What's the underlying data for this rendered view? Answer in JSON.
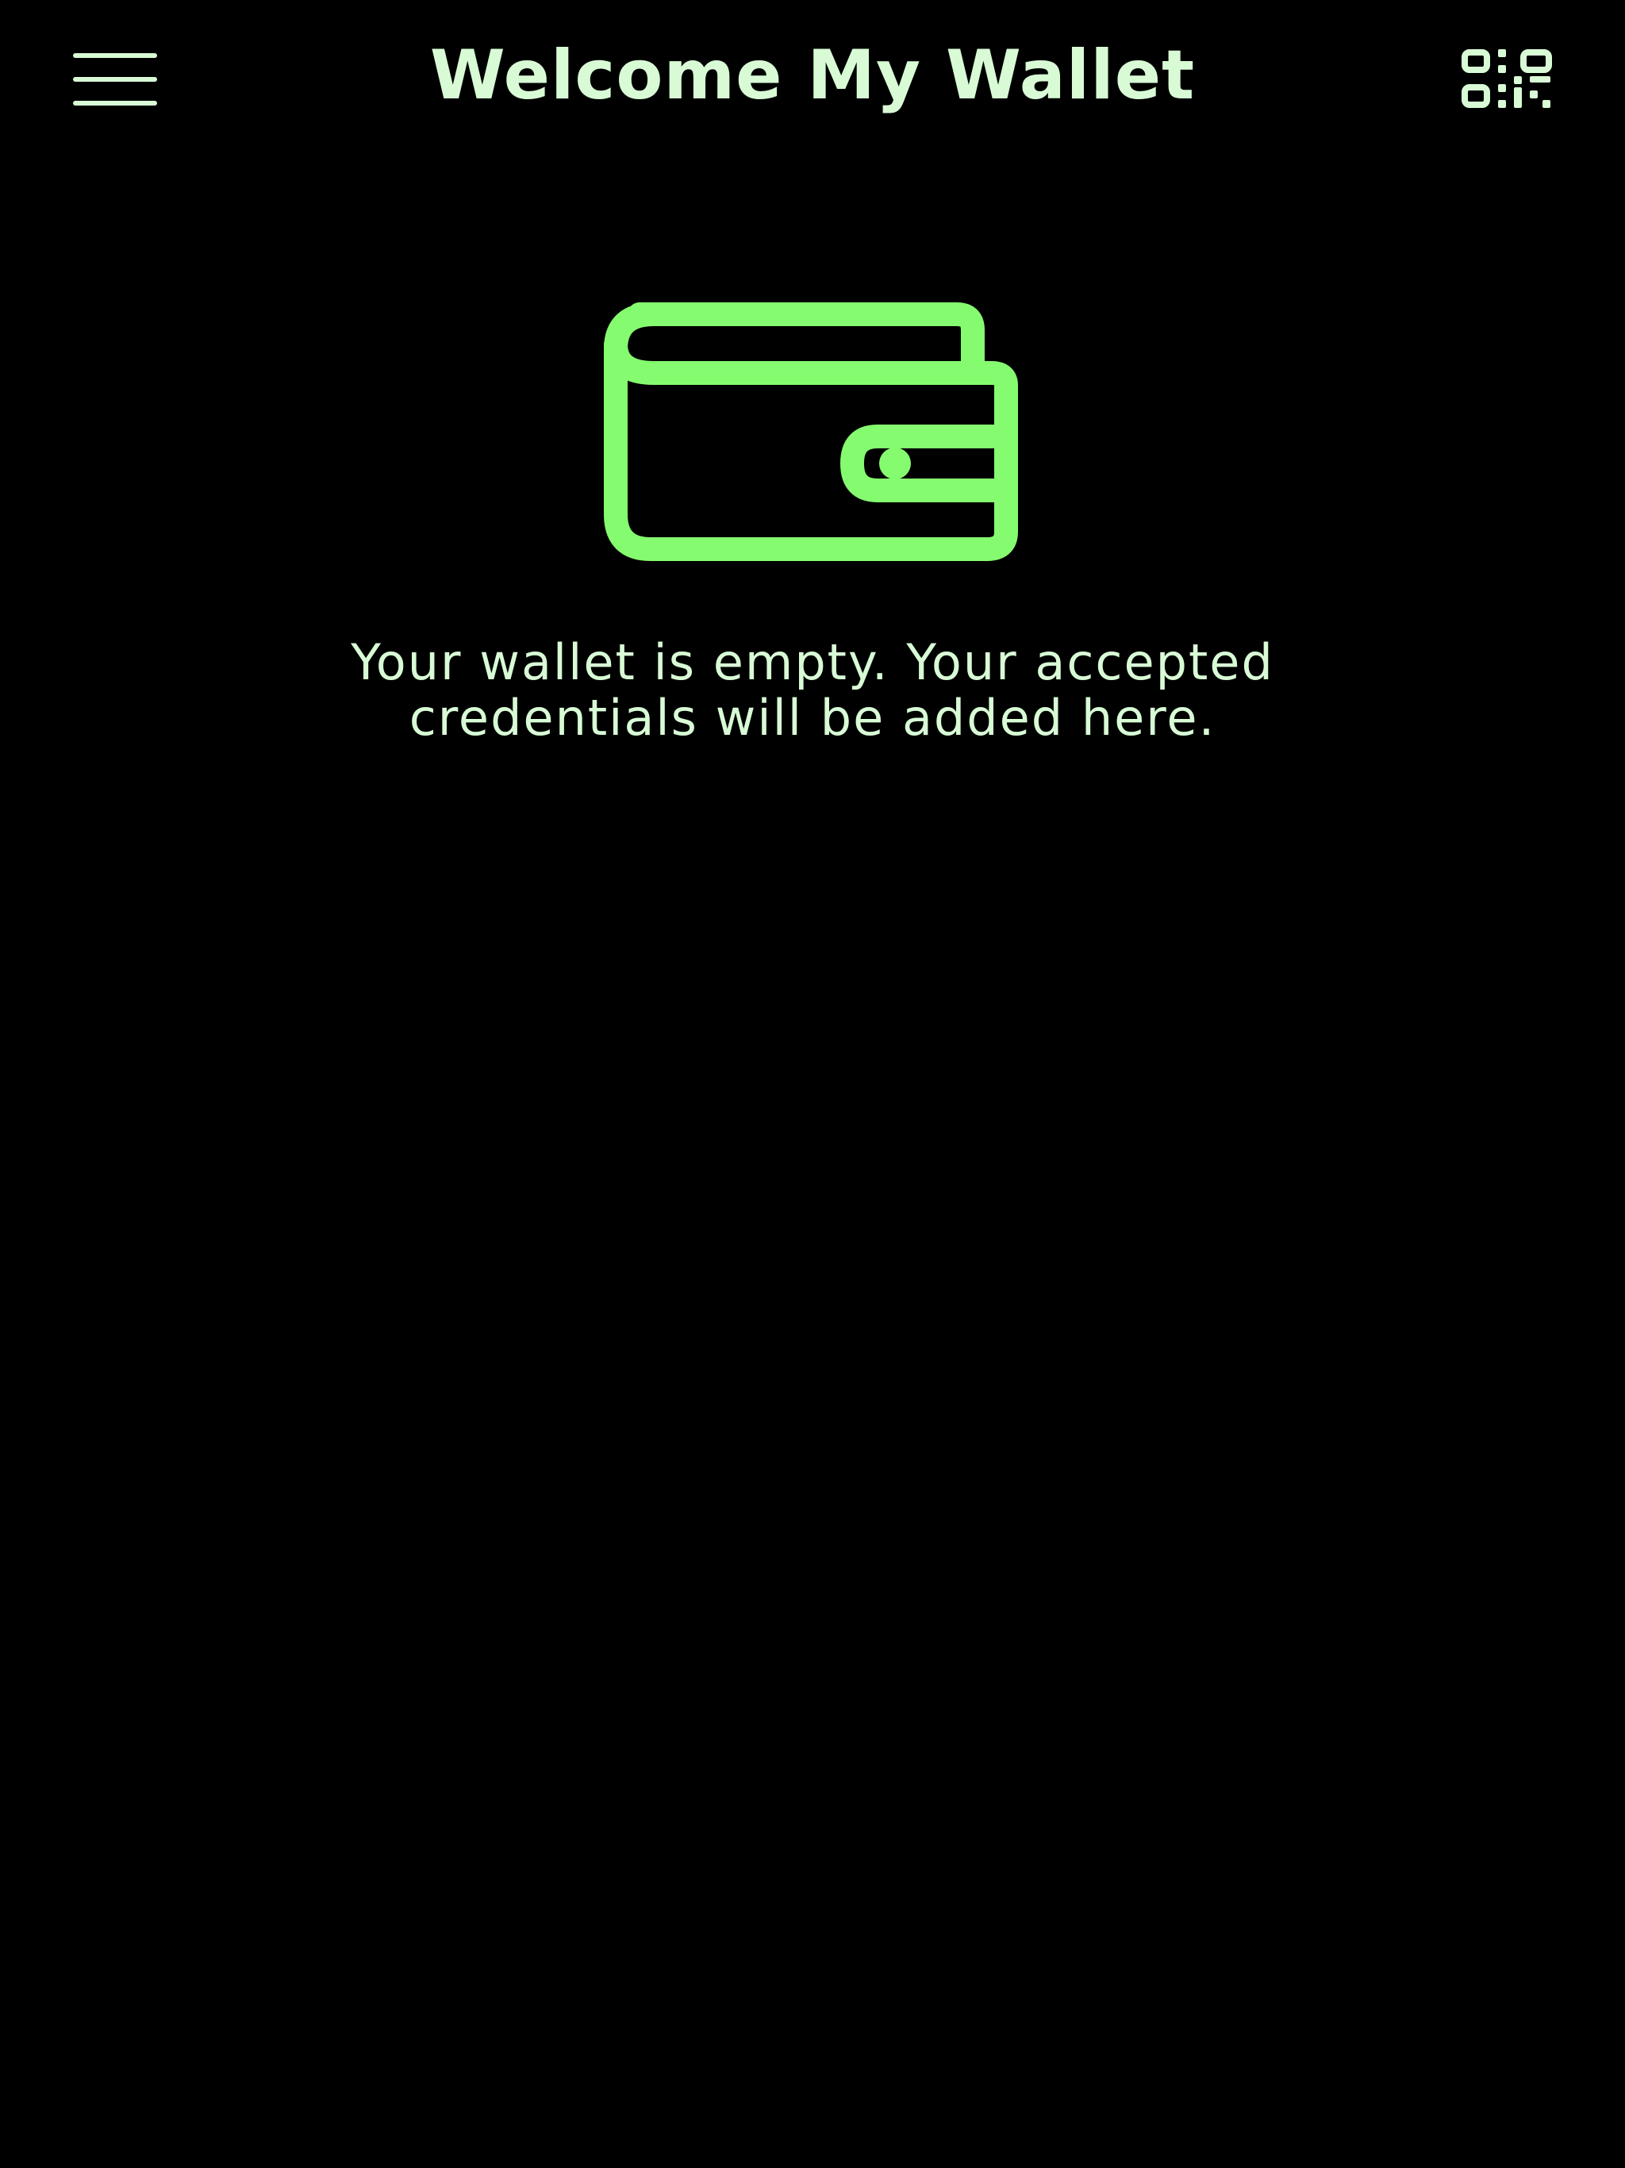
{
  "header": {
    "title": "Welcome My Wallet",
    "menu_icon": "hamburger-menu-icon",
    "scan_icon": "qr-code-icon"
  },
  "empty_state": {
    "icon": "wallet-icon",
    "message": "Your wallet is empty. Your accepted credentials will be added here."
  },
  "colors": {
    "background": "#000000",
    "text": "#d8fbd6",
    "accent": "#85fb6f"
  }
}
